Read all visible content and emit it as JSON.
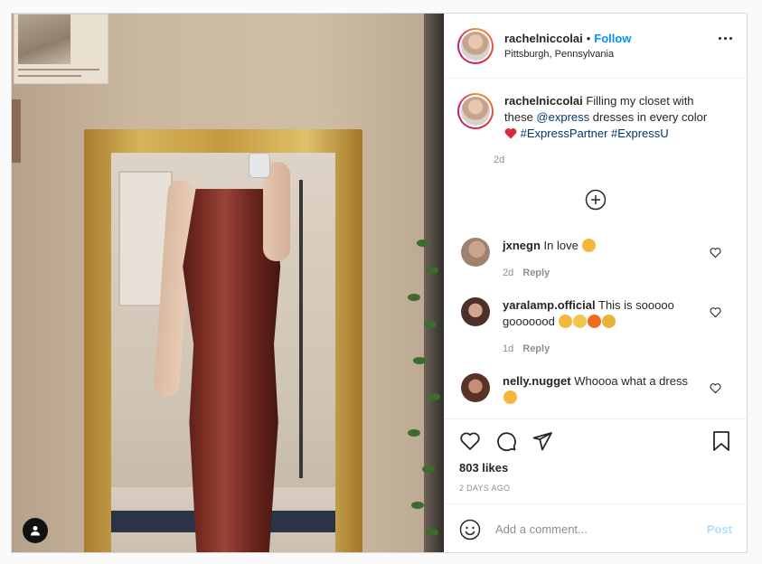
{
  "post": {
    "author": {
      "username": "rachelniccolai",
      "location": "Pittsburgh, Pennsylvania"
    },
    "follow_label": "Follow",
    "dot_separator": "•",
    "caption": {
      "username": "rachelniccolai",
      "text_before": "Filling my closet with these ",
      "mention": "@express",
      "text_after": " dresses in every color ",
      "hashtags": "#ExpressPartner #ExpressU",
      "age": "2d"
    },
    "comments": [
      {
        "username": "jxnegn",
        "text": "In love",
        "age": "2d",
        "reply_label": "Reply",
        "avatar_color": "#b59a86",
        "emoji": [
          "heart-eyes"
        ]
      },
      {
        "username": "yaralamp.official",
        "text": "This is sooooo gooooood",
        "age": "1d",
        "reply_label": "Reply",
        "avatar_color": "#9c7b6a",
        "emoji": [
          "heart-eyes",
          "clap",
          "fire",
          "raised-hands"
        ]
      },
      {
        "username": "nelly.nugget",
        "text": "Whoooa what a dress",
        "age": "",
        "reply_label": "",
        "avatar_color": "#7a5244",
        "emoji": [
          "heart-eyes"
        ]
      }
    ],
    "likes_text": "803 likes",
    "date_text": "2 DAYS AGO",
    "add_comment_placeholder": "Add a comment...",
    "post_button_label": "Post"
  },
  "colors": {
    "accent_blue": "#0095f6",
    "post_disabled": "#b2dffc",
    "link_dark": "#00376b",
    "muted": "#8e8e8e",
    "dress": "#7a2d23"
  },
  "icons": [
    "more-icon",
    "plus-circle-icon",
    "heart-icon",
    "comment-icon",
    "share-icon",
    "bookmark-icon",
    "smile-icon",
    "user-icon"
  ]
}
